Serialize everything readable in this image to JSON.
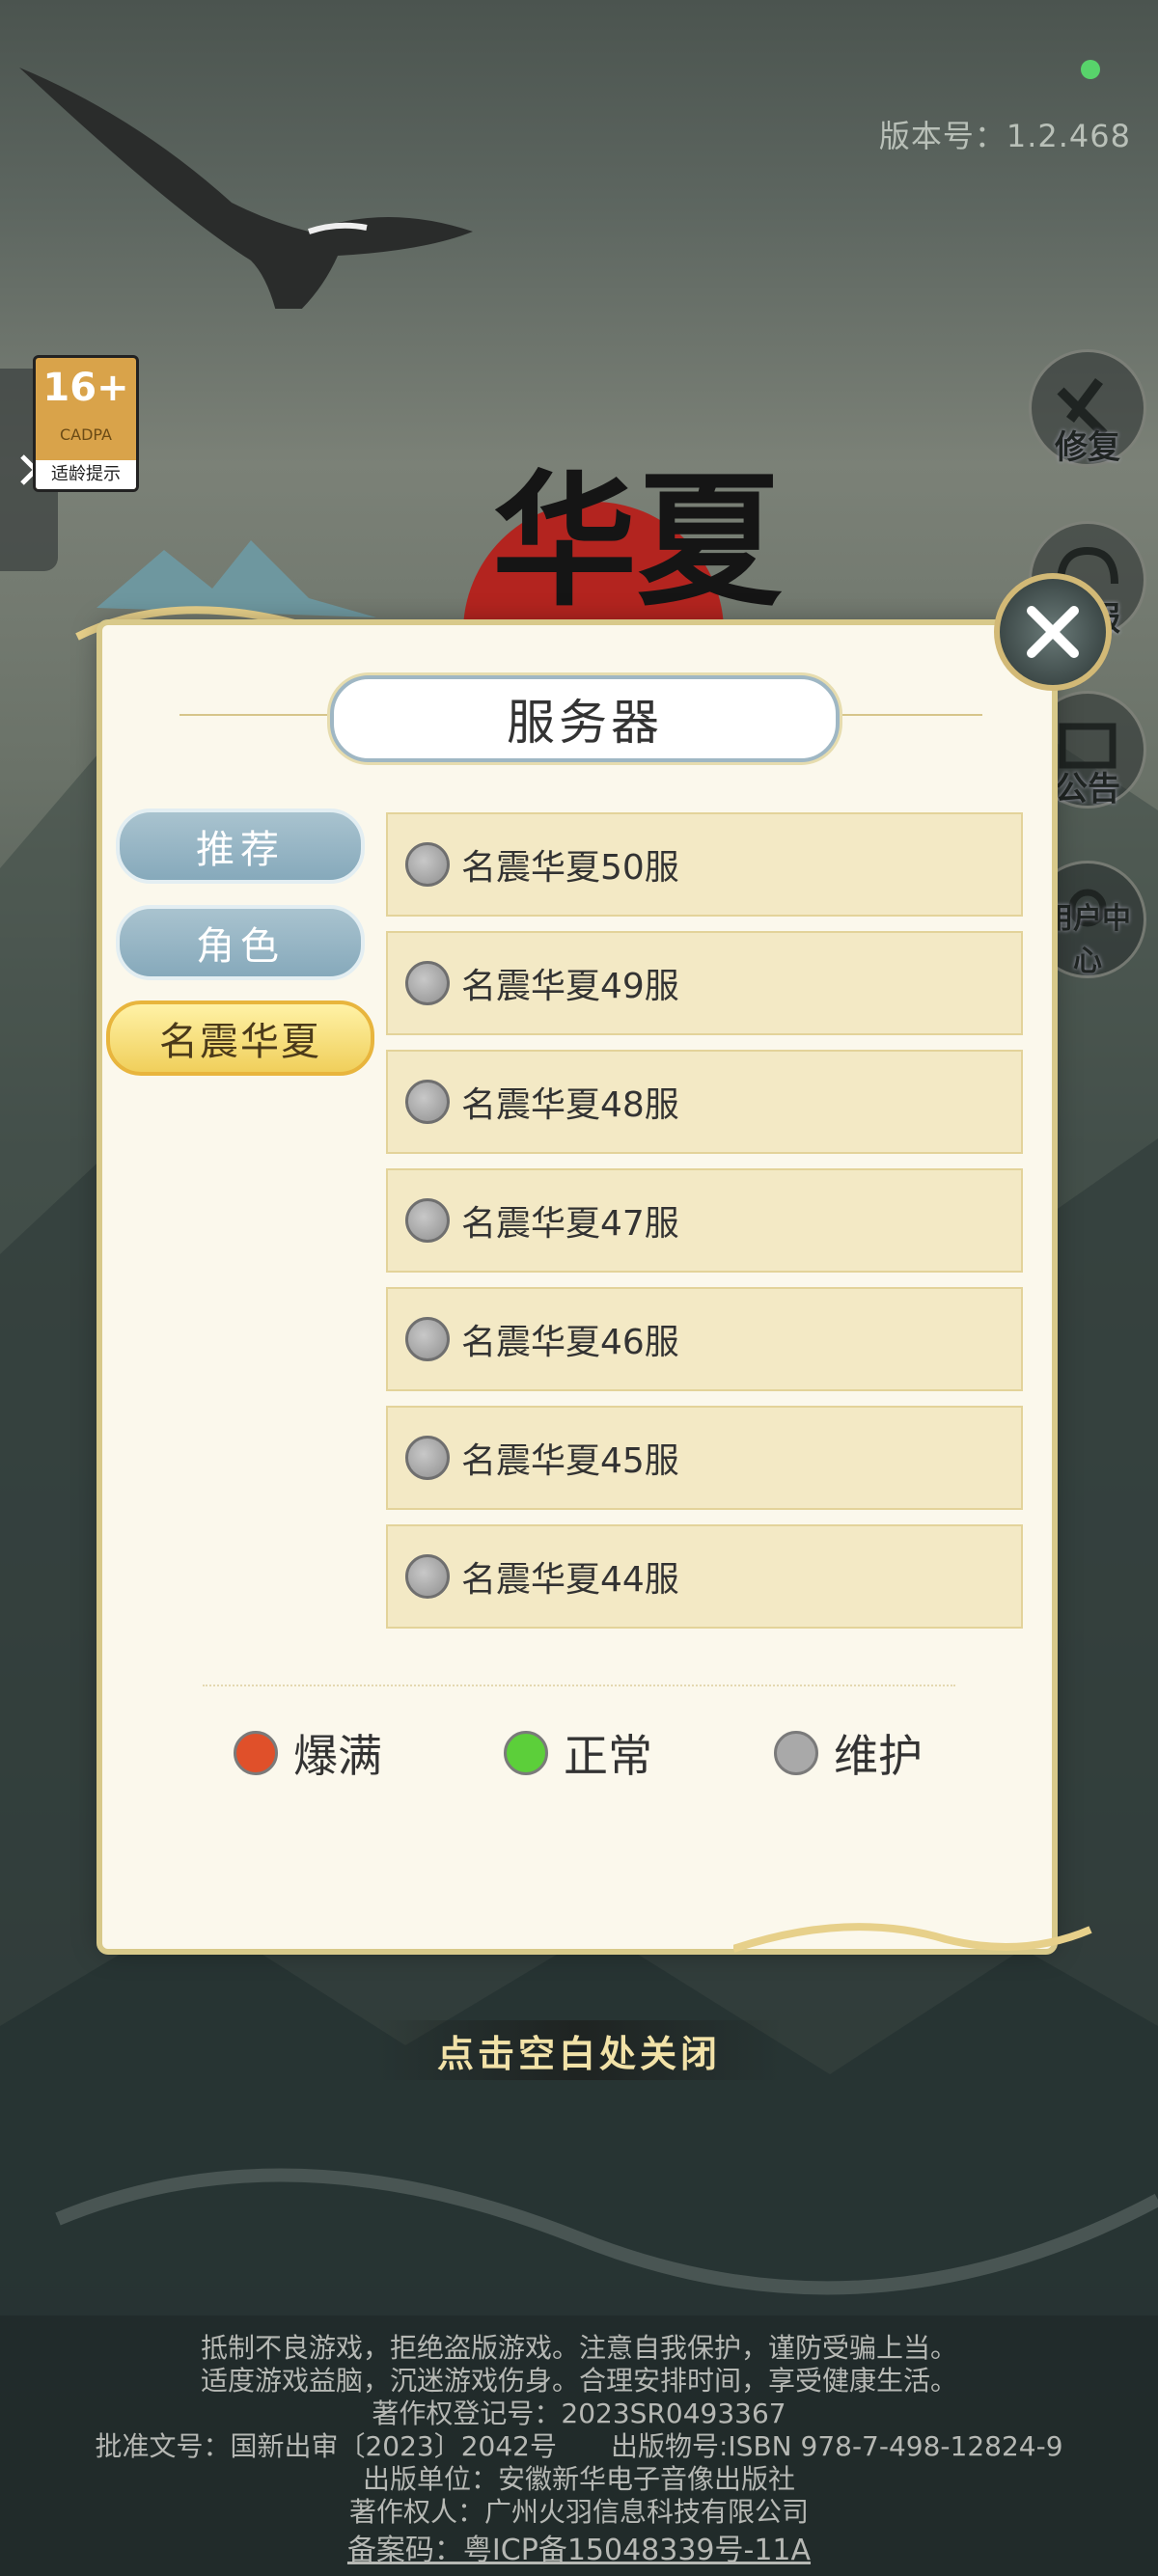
{
  "version_label": "版本号：1.2.468",
  "age_badge": {
    "rating": "16+",
    "org": "CADPA",
    "tip": "适龄提示"
  },
  "right_buttons": [
    {
      "label": "修复",
      "icon": "wrench-icon"
    },
    {
      "label": "客服",
      "icon": "headset-icon"
    },
    {
      "label": "公告",
      "icon": "notice-icon"
    },
    {
      "label": "用户中心",
      "icon": "user-icon"
    }
  ],
  "logo_text": "华夏",
  "dialog": {
    "title": "服务器",
    "tabs": [
      {
        "label": "推荐",
        "active": false
      },
      {
        "label": "角色",
        "active": false
      },
      {
        "label": "名震华夏",
        "active": true
      }
    ],
    "servers": [
      {
        "name": "名震华夏50服",
        "status": "维护"
      },
      {
        "name": "名震华夏49服",
        "status": "维护"
      },
      {
        "name": "名震华夏48服",
        "status": "维护"
      },
      {
        "name": "名震华夏47服",
        "status": "维护"
      },
      {
        "name": "名震华夏46服",
        "status": "维护"
      },
      {
        "name": "名震华夏45服",
        "status": "维护"
      },
      {
        "name": "名震华夏44服",
        "status": "维护"
      }
    ],
    "legend": [
      {
        "label": "爆满",
        "color": "#e0502a"
      },
      {
        "label": "正常",
        "color": "#5ccf3a"
      },
      {
        "label": "维护",
        "color": "#a9a9a9"
      }
    ]
  },
  "close_hint": "点击空白处关闭",
  "footer": [
    "抵制不良游戏，拒绝盗版游戏。注意自我保护，谨防受骗上当。",
    "适度游戏益脑，沉迷游戏伤身。合理安排时间，享受健康生活。",
    "著作权登记号：2023SR0493367",
    "批准文号：国新出审〔2023〕2042号　　出版物号:ISBN 978-7-498-12824-9",
    "出版单位：安徽新华电子音像出版社",
    "著作权人：广州火羽信息科技有限公司",
    "备案码：粤ICP备15048339号-11A"
  ],
  "colors": {
    "status_online": "#58d36b",
    "dialog_bg": "#fbf8ec",
    "server_bg": "#f3e9c5"
  }
}
